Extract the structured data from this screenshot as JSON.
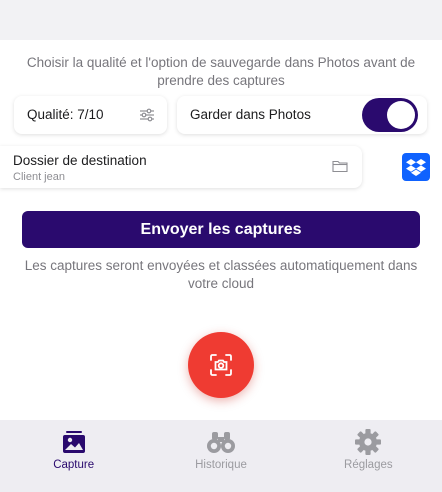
{
  "intro_text": "Choisir la qualité et l'option de sauvegarde dans Photos avant de prendre des captures",
  "quality": {
    "label": "Qualité: 7/10",
    "icon": "sliders-icon"
  },
  "keep_in_photos": {
    "label": "Garder dans Photos",
    "enabled": true
  },
  "destination": {
    "title": "Dossier de destination",
    "subtitle": "Client jean",
    "icon": "folder-icon"
  },
  "cloud_service_icon": "dropbox-icon",
  "send_button": {
    "label": "Envoyer les captures"
  },
  "send_note": "Les captures seront envoyées et classées automatiquement dans votre cloud",
  "tabs": [
    {
      "label": "Capture",
      "icon": "image-stack-icon",
      "active": true
    },
    {
      "label": "Historique",
      "icon": "binoculars-icon",
      "active": false
    },
    {
      "label": "Réglages",
      "icon": "gear-icon",
      "active": false
    }
  ],
  "colors": {
    "accent": "#2a0a6e",
    "capture": "#ef3b32",
    "dropbox": "#0f62fe"
  }
}
